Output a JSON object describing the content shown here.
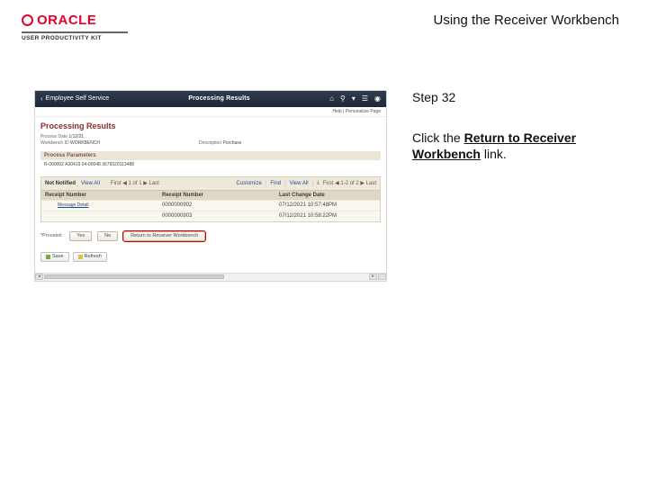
{
  "brand": {
    "name": "ORACLE",
    "subline": "USER PRODUCTIVITY KIT"
  },
  "doc": {
    "title": "Using the Receiver Workbench"
  },
  "step": {
    "label": "Step 32",
    "text_prefix": "Click the ",
    "text_link": "Return to Receiver Workbench",
    "text_suffix": " link."
  },
  "app": {
    "back_label": "Employee Self Service",
    "screen_title": "Processing Results",
    "top_right_links": "Help | Personalize Page",
    "page_heading": "Processing Results",
    "rows": {
      "date_label": "Process Date",
      "date_value": "1/12/21",
      "workbench_label": "Workbench ID",
      "workbench_value": "WORKBENCH",
      "desc_label": "Description",
      "desc_value": "Purchase"
    },
    "section": "Process Parameters",
    "params_line": "R-000002  A30419  04-00048  3676020113488",
    "grid": {
      "title": "Not Notified",
      "viewall": "View All",
      "nav": "First  ◀  1 of 1  ▶  Last",
      "right1": "Customize",
      "right2": "Find",
      "right3": "View All",
      "pager": "First ◀ 1-2 of 2 ▶ Last",
      "col1": "Receipt Number",
      "col2": "Receipt Number",
      "col3": "Last Change Date",
      "msg_link": "Message Detail",
      "row1_b": "0000000902",
      "row1_c": "07/12/2021 10:57:48PM",
      "row2_b": "0000000903",
      "row2_c": "07/12/2021 10:58:22PM"
    },
    "buttons": {
      "proceed_label": "*Proceed:",
      "yes": "Yes",
      "no": "No",
      "return": "Return to Receiver Workbench",
      "save": "Save",
      "refresh": "Refresh"
    }
  }
}
